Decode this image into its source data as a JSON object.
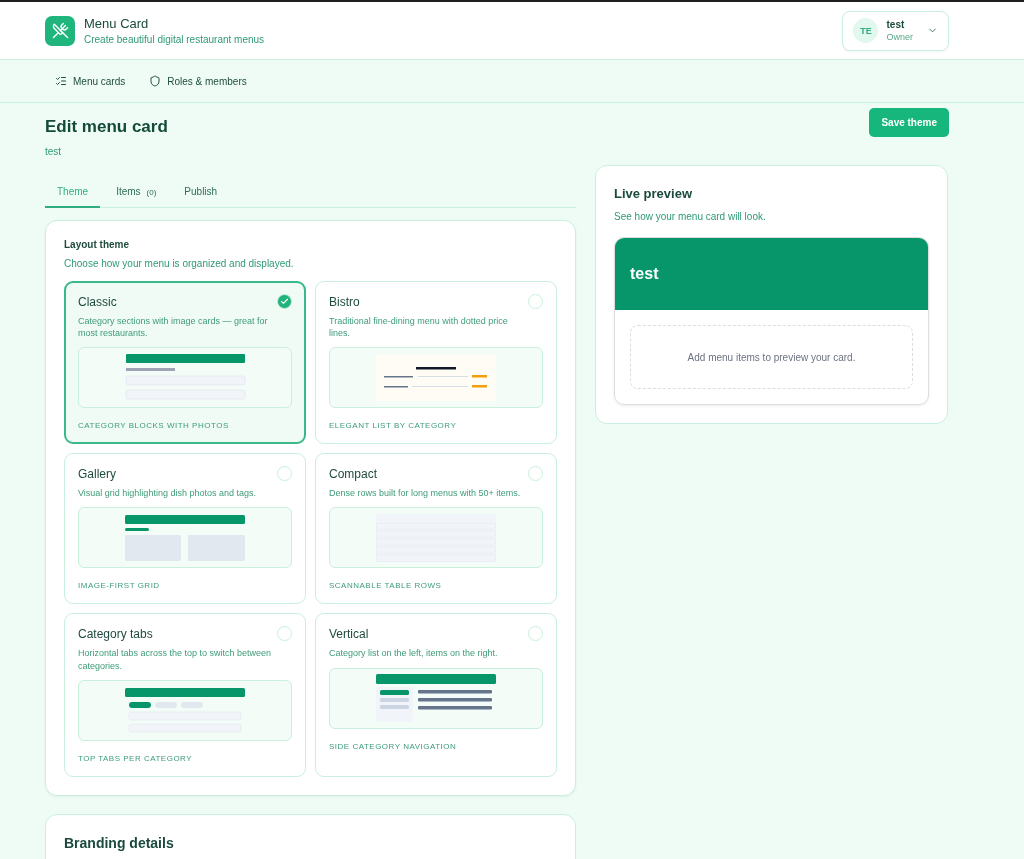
{
  "app": {
    "title": "Menu Card",
    "subtitle": "Create beautiful digital restaurant menus"
  },
  "user": {
    "initials": "TE",
    "name": "test",
    "role": "Owner"
  },
  "nav": [
    {
      "label": "Menu cards"
    },
    {
      "label": "Roles & members"
    }
  ],
  "page": {
    "title": "Edit menu card",
    "subtitle": "test",
    "action": "Save theme"
  },
  "tabs": [
    {
      "label": "Theme",
      "selected": true
    },
    {
      "label": "Items",
      "count": "(0)",
      "selected": false
    },
    {
      "label": "Publish",
      "selected": false
    }
  ],
  "layout_theme": {
    "title": "Layout theme",
    "description": "Choose how your menu is organized and displayed.",
    "options": [
      {
        "kind": "classic",
        "name": "Classic",
        "description": "Category sections with image cards — great for most restaurants.",
        "tag": "CATEGORY BLOCKS WITH PHOTOS",
        "selected": true
      },
      {
        "kind": "bistro",
        "name": "Bistro",
        "description": "Traditional fine-dining menu with dotted price lines.",
        "tag": "ELEGANT LIST BY CATEGORY",
        "selected": false
      },
      {
        "kind": "gallery",
        "name": "Gallery",
        "description": "Visual grid highlighting dish photos and tags.",
        "tag": "IMAGE-FIRST GRID",
        "selected": false
      },
      {
        "kind": "compact",
        "name": "Compact",
        "description": "Dense rows built for long menus with 50+ items.",
        "tag": "SCANNABLE TABLE ROWS",
        "selected": false
      },
      {
        "kind": "tabs",
        "name": "Category tabs",
        "description": "Horizontal tabs across the top to switch between categories.",
        "tag": "TOP TABS PER CATEGORY",
        "selected": false
      },
      {
        "kind": "vertical",
        "name": "Vertical",
        "description": "Category list on the left, items on the right.",
        "tag": "SIDE CATEGORY NAVIGATION",
        "selected": false
      }
    ]
  },
  "branding": {
    "title": "Branding details"
  },
  "preview": {
    "title": "Live preview",
    "description": "See how your menu card will look.",
    "card_title": "test",
    "empty_message": "Add menu items to preview your card."
  }
}
